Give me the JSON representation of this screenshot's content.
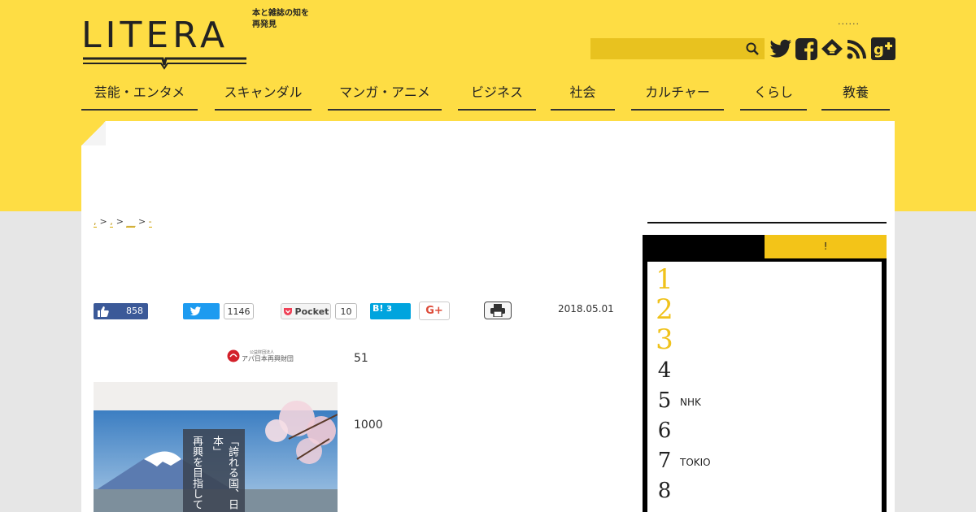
{
  "brand": {
    "logo_text": "LITERA",
    "tagline": "本と雑誌の知を再発見"
  },
  "header": {
    "dots": "......",
    "search": {
      "placeholder": "",
      "value": ""
    }
  },
  "social_icons": [
    "twitter-icon",
    "facebook-icon",
    "feedly-icon",
    "rss-icon",
    "google-plus-icon"
  ],
  "nav": {
    "items": [
      {
        "label": "芸能・エンタメ"
      },
      {
        "label": "スキャンダル"
      },
      {
        "label": "マンガ・アニメ"
      },
      {
        "label": "ビジネス"
      },
      {
        "label": "社会"
      },
      {
        "label": "カルチャー"
      },
      {
        "label": "くらし"
      },
      {
        "label": "教養"
      }
    ]
  },
  "breadcrumb": {
    "sep": ">",
    "items": [
      ",",
      ",",
      "__",
      "-"
    ]
  },
  "share": {
    "facebook_count": "858",
    "twitter_count": "1146",
    "pocket_label": "Pocket",
    "pocket_count": "10",
    "hatena_label": "B!",
    "hatena_count": "3",
    "gplus_label": "G+"
  },
  "article": {
    "date": "2018.05.01",
    "para1": "51",
    "para2": "1000",
    "image_caption_lines": [
      "「誇れる国、日本」",
      "再興を目指して"
    ],
    "sponsor_small": "公益財団法人",
    "sponsor_name": "アパ日本再興財団"
  },
  "sidebar": {
    "tab_left": "",
    "tab_right": "!",
    "ranking": [
      {
        "rank": "1",
        "title": ""
      },
      {
        "rank": "2",
        "title": ""
      },
      {
        "rank": "3",
        "title": ""
      },
      {
        "rank": "4",
        "title": ""
      },
      {
        "rank": "5",
        "title": "NHK"
      },
      {
        "rank": "6",
        "title": ""
      },
      {
        "rank": "7",
        "title": "TOKIO"
      },
      {
        "rank": "8",
        "title": ""
      }
    ]
  },
  "colors": {
    "brand_yellow": "#fedd44",
    "accent_yellow": "#f0c21c",
    "facebook": "#3b5998",
    "twitter": "#1d9bf0",
    "hatena": "#00a4de"
  }
}
